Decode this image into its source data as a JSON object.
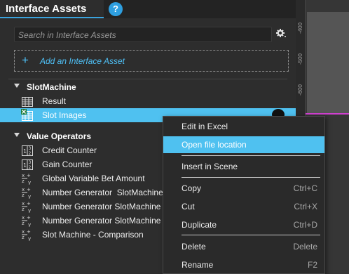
{
  "header": {
    "title": "Interface Assets",
    "help_glyph": "?"
  },
  "search": {
    "placeholder": "Search in Interface Assets"
  },
  "add": {
    "plus": "+",
    "label": "Add an Interface Asset"
  },
  "groups": [
    {
      "name": "SlotMachine",
      "items": [
        {
          "label": "Result",
          "icon": "table-icon",
          "selected": false
        },
        {
          "label": "Slot Images",
          "icon": "excel-table-icon",
          "selected": true
        }
      ]
    },
    {
      "name": "Value Operators",
      "items": [
        {
          "label": "Credit Counter",
          "icon": "counter-icon"
        },
        {
          "label": "Gain Counter",
          "icon": "counter-icon"
        },
        {
          "label": "Global Variable Bet Amount",
          "icon": "formula-icon"
        },
        {
          "label": "Number Generator  SlotMachine",
          "icon": "formula-icon"
        },
        {
          "label": "Number Generator SlotMachine",
          "icon": "formula-icon"
        },
        {
          "label": "Number Generator SlotMachine",
          "icon": "formula-icon"
        },
        {
          "label": "Slot Machine - Comparison",
          "icon": "formula-icon"
        }
      ]
    }
  ],
  "ruler": {
    "labels": [
      "-400",
      "-500",
      "-600"
    ]
  },
  "context_menu": {
    "items": [
      {
        "label": "Edit in Excel",
        "shortcut": ""
      },
      {
        "label": "Open file location",
        "shortcut": ""
      },
      {
        "label": "Insert in Scene",
        "shortcut": ""
      },
      {
        "label": "Copy",
        "shortcut": "Ctrl+C"
      },
      {
        "label": "Cut",
        "shortcut": "Ctrl+X"
      },
      {
        "label": "Duplicate",
        "shortcut": "Ctrl+D"
      },
      {
        "label": "Delete",
        "shortcut": "Delete"
      },
      {
        "label": "Rename",
        "shortcut": "F2"
      }
    ],
    "active_index": 1
  },
  "colors": {
    "accent": "#4fc1f0",
    "tab_underline": "#3aa3dd",
    "guide": "#d040d0"
  }
}
